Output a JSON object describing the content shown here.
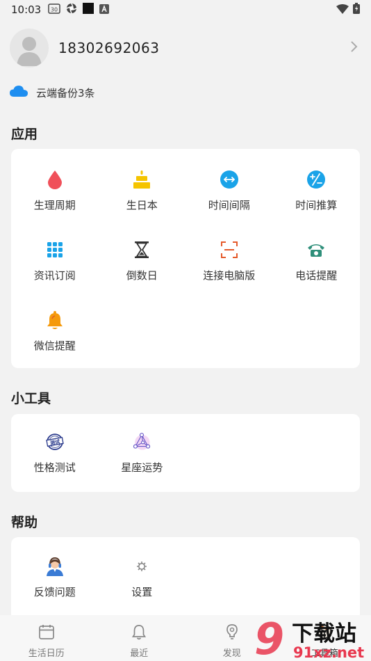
{
  "status": {
    "time": "10:03",
    "calendar_day": "30"
  },
  "profile": {
    "phone": "18302692063"
  },
  "cloud": {
    "text": "云端备份3条"
  },
  "sections": {
    "apps": {
      "title": "应用",
      "items": [
        {
          "label": "生理周期",
          "icon": "drop-icon",
          "color": "#f0505a"
        },
        {
          "label": "生日本",
          "icon": "cake-icon",
          "color": "#f5c400"
        },
        {
          "label": "时间间隔",
          "icon": "interval-icon",
          "color": "#1aa3e8"
        },
        {
          "label": "时间推算",
          "icon": "calc-icon",
          "color": "#1aa3e8"
        },
        {
          "label": "资讯订阅",
          "icon": "grid-icon",
          "color": "#1aa3e8"
        },
        {
          "label": "倒数日",
          "icon": "hourglass-icon",
          "color": "#333333"
        },
        {
          "label": "连接电脑版",
          "icon": "scan-icon",
          "color": "#e55a2b"
        },
        {
          "label": "电话提醒",
          "icon": "phone-icon",
          "color": "#2f8f7a"
        },
        {
          "label": "微信提醒",
          "icon": "bell-icon",
          "color": "#f59a0c"
        }
      ]
    },
    "tools": {
      "title": "小工具",
      "items": [
        {
          "label": "性格测试",
          "icon": "test-stamp-icon",
          "stamp_text": "测试"
        },
        {
          "label": "星座运势",
          "icon": "constellation-icon"
        }
      ]
    },
    "help": {
      "title": "帮助",
      "items": [
        {
          "label": "反馈问题",
          "icon": "support-agent-icon"
        },
        {
          "label": "设置",
          "icon": "gear-icon"
        }
      ]
    }
  },
  "tabs": [
    {
      "label": "生活日历",
      "icon": "calendar-icon"
    },
    {
      "label": "最近",
      "icon": "bell-icon"
    },
    {
      "label": "发现",
      "icon": "bulb-icon"
    },
    {
      "label": "工具箱",
      "icon": "toolbox-icon"
    }
  ],
  "watermark": {
    "brand": "下载站",
    "domain": "91xz.net",
    "logo": "9"
  },
  "colors": {
    "background": "#f2f2f2",
    "card": "#ffffff",
    "accent_blue": "#1aa3e8"
  }
}
